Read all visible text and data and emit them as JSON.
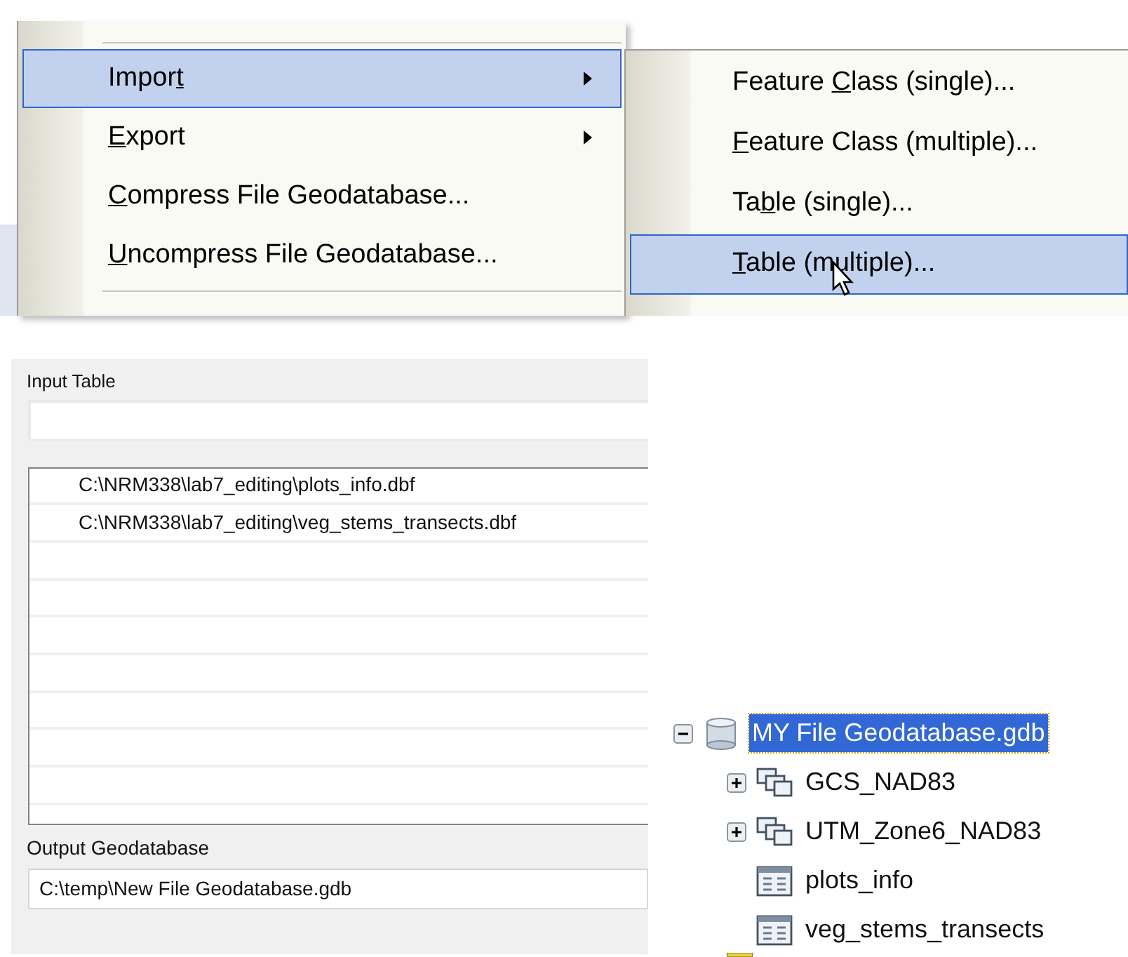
{
  "context_menu": {
    "items": [
      {
        "before": "Impor",
        "key": "t",
        "submenu": true,
        "selected": true
      },
      {
        "key": "E",
        "after": "xport",
        "submenu": true,
        "selected": false
      },
      {
        "key": "C",
        "after": "ompress File Geodatabase...",
        "submenu": false,
        "selected": false
      },
      {
        "key": "U",
        "after": "ncompress File Geodatabase...",
        "submenu": false,
        "selected": false
      }
    ]
  },
  "submenu": {
    "items": [
      {
        "before": "Feature ",
        "key": "C",
        "after": "lass (single)...",
        "selected": false
      },
      {
        "key": "F",
        "after": "eature Class (multiple)...",
        "selected": false
      },
      {
        "before": "Ta",
        "key": "b",
        "after": "le (single)...",
        "selected": false
      },
      {
        "key": "T",
        "after": "able (multiple)...",
        "selected": true
      }
    ]
  },
  "dialog": {
    "input_label": "Input Table",
    "rows": [
      "C:\\NRM338\\lab7_editing\\plots_info.dbf",
      "C:\\NRM338\\lab7_editing\\veg_stems_transects.dbf"
    ],
    "output_label": "Output Geodatabase",
    "output_value": "C:\\temp\\New File Geodatabase.gdb"
  },
  "catalog_tree": {
    "label": "MY File Geodatabase.gdb",
    "kind": "geodatabase",
    "expanded": true,
    "selected": true,
    "children": [
      {
        "label": "GCS_NAD83",
        "kind": "dataset",
        "expanded": false
      },
      {
        "label": "UTM_Zone6_NAD83",
        "kind": "dataset",
        "expanded": false
      },
      {
        "label": "plots_info",
        "kind": "table"
      },
      {
        "label": "veg_stems_transects",
        "kind": "table"
      }
    ]
  }
}
